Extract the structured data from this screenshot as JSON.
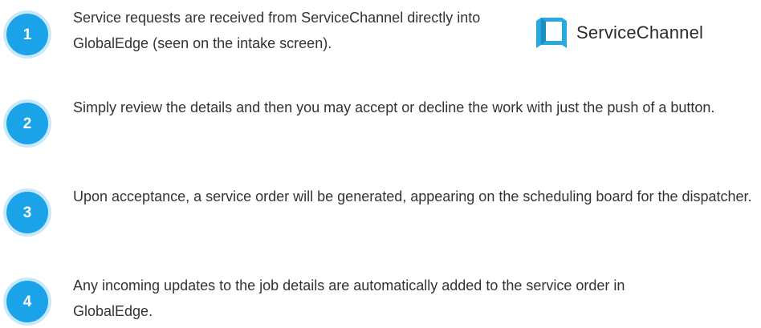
{
  "steps": [
    {
      "number": "1",
      "text": "Service requests are received from ServiceChannel directly into GlobalEdge (seen on the intake screen)."
    },
    {
      "number": "2",
      "text": "Simply review the details and then you may accept or decline the work with just the push of a button."
    },
    {
      "number": "3",
      "text": "Upon acceptance, a service order will be generated, appearing on the scheduling board for the dispatcher."
    },
    {
      "number": "4",
      "text": "Any incoming updates to the job details are automatically added to the service order in GlobalEdge."
    }
  ],
  "logo": {
    "text": "ServiceChannel",
    "icon": "servicechannel-logo-icon",
    "color": "#2aa8e0"
  },
  "colors": {
    "badge": "#1aa3e8",
    "badge_ring": "#c9e9fa",
    "text": "#333333"
  }
}
